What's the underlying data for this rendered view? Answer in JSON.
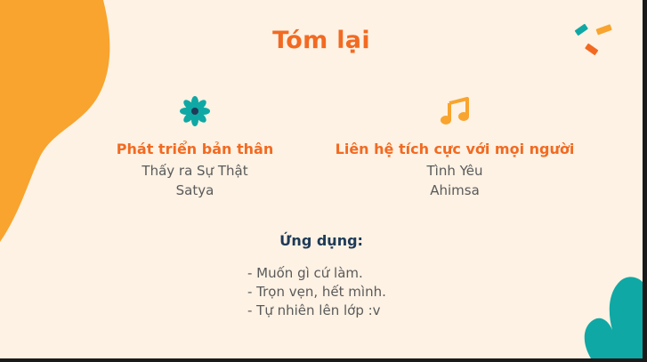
{
  "slide": {
    "title": "Tóm lại",
    "colors": {
      "accent": "#f26a21",
      "blob": "#f8a42e",
      "teal": "#10a8a4",
      "navy": "#1f3a57",
      "background": "#fdf2e4"
    }
  },
  "left": {
    "icon": "flower-icon",
    "heading": "Phát triển bản thân",
    "line1": "Thấy ra Sự Thật",
    "line2": "Satya"
  },
  "right": {
    "icon": "music-note-icon",
    "heading": "Liên hệ tích cực với mọi người",
    "line1": "Tình Yêu",
    "line2": "Ahimsa"
  },
  "apply": {
    "title": "Ứng dụng:",
    "items": [
      "-  Muốn gì cứ làm.",
      "-  Trọn vẹn, hết mình.",
      "-  Tự nhiên lên lớp :v"
    ]
  }
}
